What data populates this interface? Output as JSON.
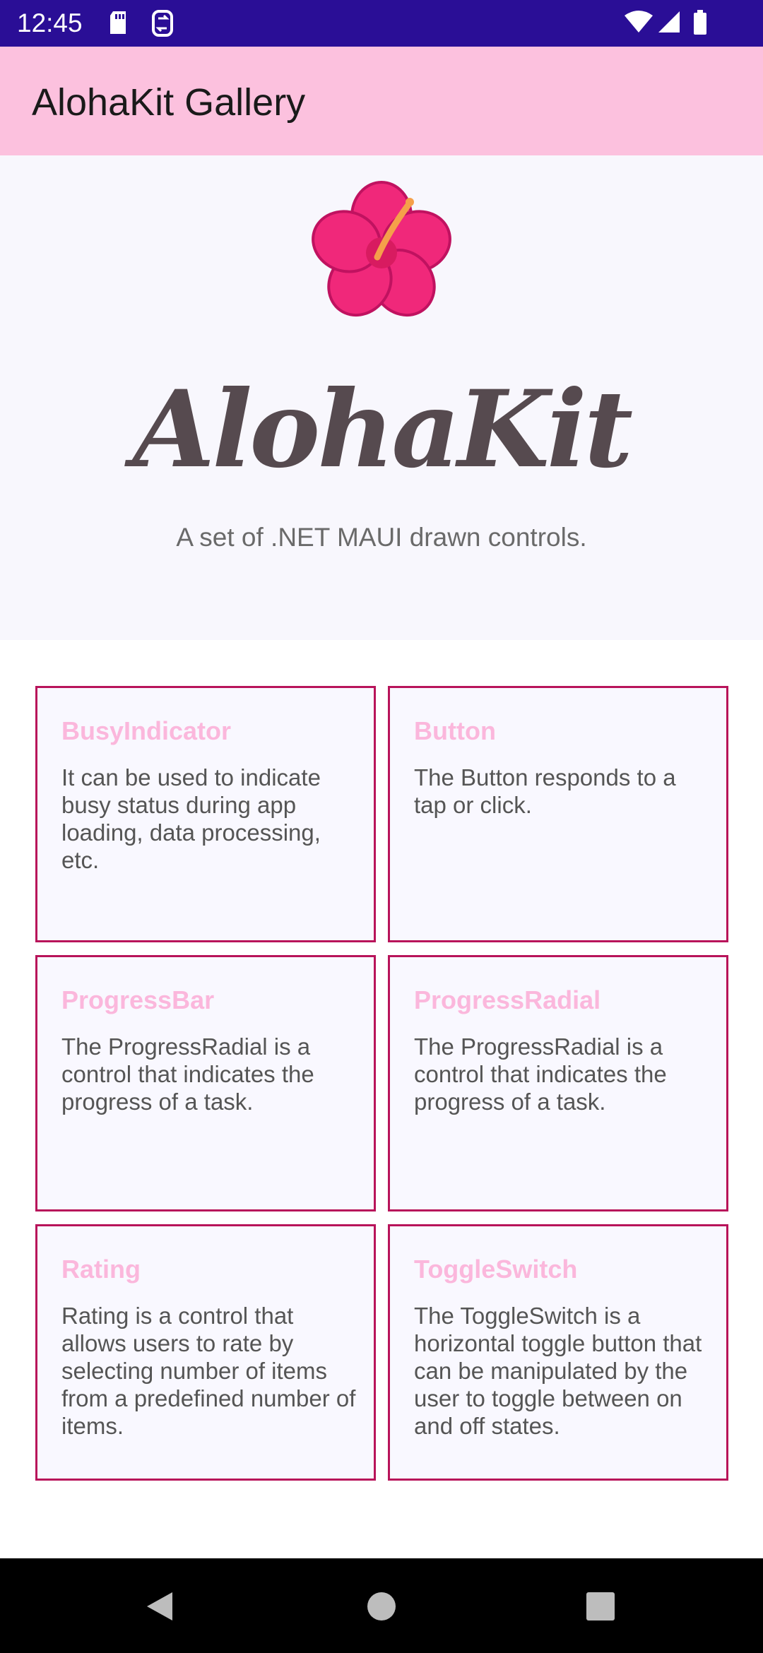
{
  "status_bar": {
    "time": "12:45",
    "background": "#2a0e96",
    "left_icons": [
      "sd-card-icon",
      "sim-sync-icon"
    ],
    "right_icons": [
      "wifi-icon",
      "cell-signal-icon",
      "battery-icon"
    ]
  },
  "app_bar": {
    "title": "AlohaKit Gallery",
    "background": "#fcc1de"
  },
  "hero": {
    "logo_icon": "hibiscus-icon",
    "wordmark": "AlohaKit",
    "tagline": "A set of .NET MAUI drawn controls."
  },
  "cards": [
    {
      "title": "BusyIndicator",
      "description": "It can be used to indicate busy status during app loading, data processing, etc."
    },
    {
      "title": "Button",
      "description": "The Button responds to a tap or click."
    },
    {
      "title": "ProgressBar",
      "description": "The ProgressRadial is a control that indicates the progress of a task."
    },
    {
      "title": "ProgressRadial",
      "description": "The ProgressRadial is a control that indicates the progress of a task."
    },
    {
      "title": "Rating",
      "description": "Rating is a control that allows users to rate by selecting number of items from a predefined number of items."
    },
    {
      "title": "ToggleSwitch",
      "description": "The ToggleSwitch is a horizontal toggle button that can be manipulated by the user to toggle between on and off states."
    }
  ],
  "colors": {
    "card_border": "#b8145a",
    "card_title": "#fbb7dc",
    "card_background": "#f9f8ff",
    "hero_background": "#f8f7fd"
  },
  "nav_bar": {
    "icons": [
      "back-icon",
      "home-icon",
      "recents-icon"
    ]
  }
}
